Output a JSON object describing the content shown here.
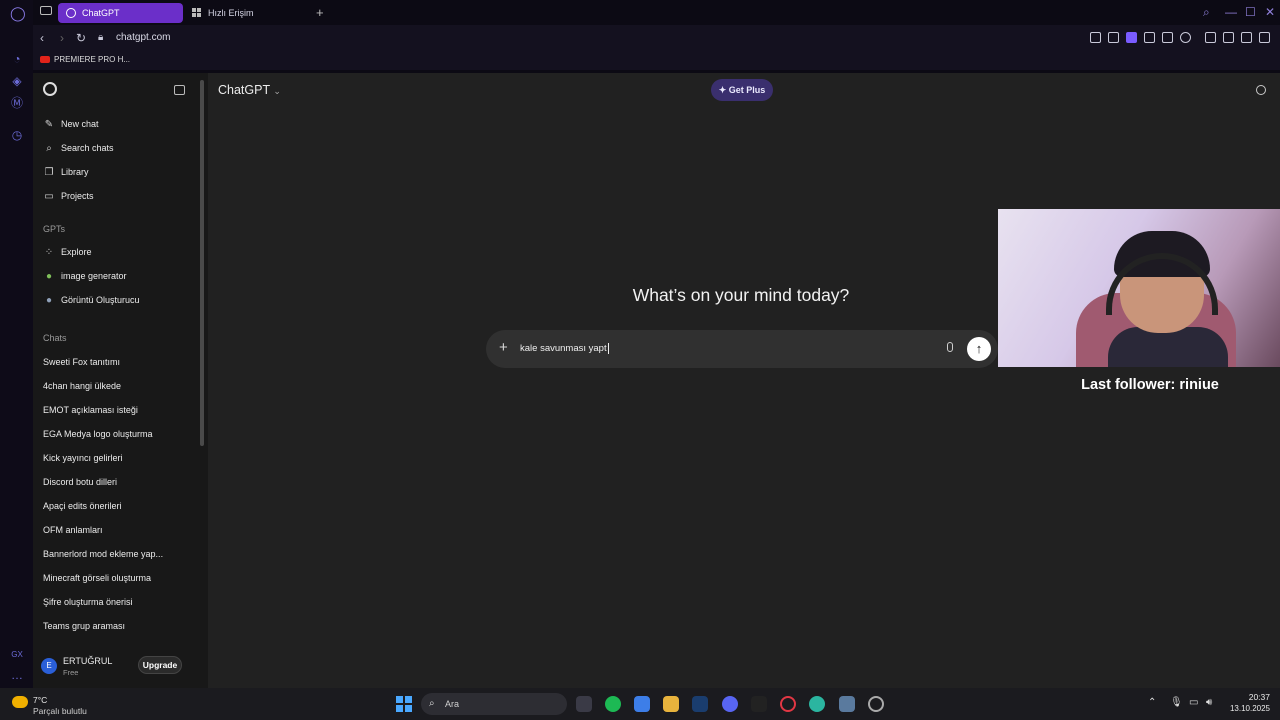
{
  "browser": {
    "tabs": [
      {
        "label": "ChatGPT",
        "active": true
      },
      {
        "label": "Hızlı Erişim",
        "active": false
      }
    ],
    "url": "chatgpt.com",
    "bookmarks": [
      {
        "label": "PREMIERE PRO H..."
      }
    ]
  },
  "sidebar": {
    "primary": [
      {
        "label": "New chat",
        "icon": "edit-icon"
      },
      {
        "label": "Search chats",
        "icon": "search-icon"
      },
      {
        "label": "Library",
        "icon": "library-icon"
      },
      {
        "label": "Projects",
        "icon": "folder-icon"
      }
    ],
    "gpts_heading": "GPTs",
    "gpts": [
      {
        "label": "Explore",
        "icon": "grid-icon"
      },
      {
        "label": "image generator",
        "icon": "gpt-avatar-icon"
      },
      {
        "label": "Görüntü Oluşturucu",
        "icon": "gpt-avatar-icon"
      }
    ],
    "chats_heading": "Chats",
    "chats": [
      "Sweeti Fox tanıtımı",
      "4chan hangi ülkede",
      "EMOT açıklaması isteği",
      "EGA Medya logo oluşturma",
      "Kick yayıncı gelirleri",
      "Discord botu dilleri",
      "Apaçi edits önerileri",
      "OFM anlamları",
      "Bannerlord mod ekleme yap...",
      "Minecraft görseli oluşturma",
      "Şifre oluşturma önerisi",
      "Teams grup araması"
    ],
    "user": {
      "initial": "E",
      "name": "ERTUĞRUL",
      "plan": "Free",
      "upgrade_label": "Upgrade"
    }
  },
  "main": {
    "model": "ChatGPT",
    "get_plus": "Get Plus",
    "headline": "What’s on your mind today?",
    "composer": {
      "value": "kale savunması yapt"
    }
  },
  "overlay": {
    "follower_text": "Last follower: riniue"
  },
  "taskbar": {
    "temperature": "7°C",
    "condition": "Parçalı bulutlu",
    "search_placeholder": "Ara",
    "time": "20:37",
    "date": "13.10.2025"
  },
  "colors": {
    "accent": "#6b2fc9",
    "get_plus_bg": "#3a2f6e",
    "main_bg": "#212121",
    "sidebar_bg": "#181818"
  }
}
